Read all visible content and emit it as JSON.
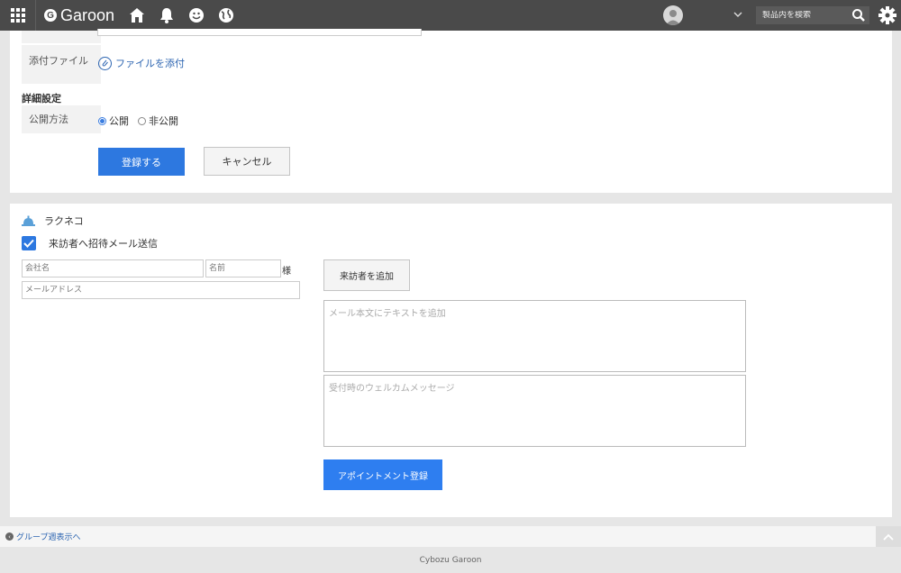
{
  "header": {
    "app_name": "Garoon",
    "search_placeholder": "製品内を検索",
    "icons": [
      "apps-grid-icon",
      "home-icon",
      "bell-icon",
      "smile-icon",
      "globe-icon",
      "avatar",
      "chevron-down-icon",
      "search-icon",
      "gear-icon"
    ],
    "bg_color": "#4a4a4a"
  },
  "form": {
    "attachment_label": "添付ファイル",
    "attach_link": "ファイルを添付",
    "section_title": "詳細設定",
    "visibility_label": "公開方法",
    "visibility_options": [
      {
        "label": "公開",
        "selected": true
      },
      {
        "label": "非公開",
        "selected": false
      }
    ],
    "submit_button": "登録する",
    "cancel_button": "キャンセル",
    "accent_color": "#2d78e0"
  },
  "rakuneko": {
    "title": "ラクネコ",
    "send_invite_label": "来訪者へ招待メール送信",
    "send_invite_checked": true,
    "company_placeholder": "会社名",
    "name_placeholder": "名前",
    "honorific": "様",
    "email_placeholder": "メールアドレス",
    "add_visitor_button": "来訪者を追加",
    "mail_body_placeholder": "メール本文にテキストを追加",
    "welcome_placeholder": "受付時のウェルカムメッセージ",
    "register_button": "アポイントメント登録"
  },
  "footer": {
    "back_link": "グループ週表示へ",
    "copyright": "Cybozu Garoon"
  }
}
